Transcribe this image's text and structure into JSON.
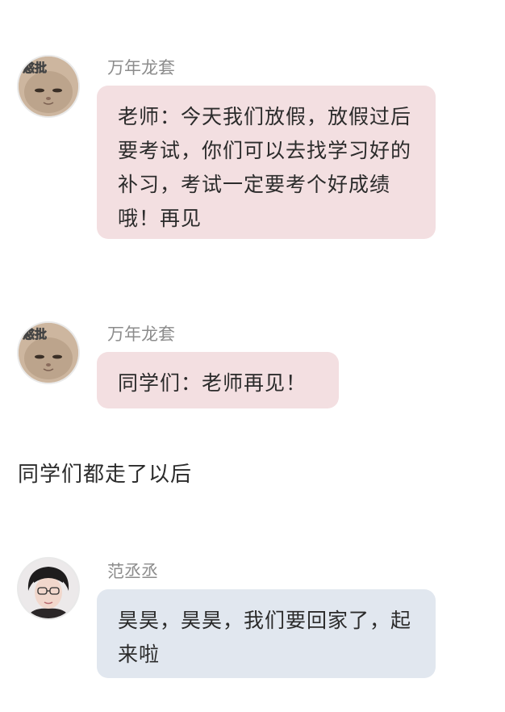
{
  "colors": {
    "teacher_bubble": "#f3dfe1",
    "student_bubble": "#e1e7ef",
    "sender_name": "#8c8c8c",
    "text": "#2b2b2b"
  },
  "messages": [
    {
      "sender": "万年龙套",
      "avatar_caption": "惑批",
      "avatar_icon": "cat-avatar-icon",
      "text": "老师：今天我们放假，放假过后要考试，你们可以去找学习好的补习，考试一定要考个好成绩哦！再见"
    },
    {
      "sender": "万年龙套",
      "avatar_caption": "惑批",
      "avatar_icon": "cat-avatar-icon",
      "text": "同学们：老师再见！"
    },
    {
      "sender": "范丞丞",
      "avatar_icon": "person-avatar-icon",
      "text": "昊昊，昊昊，我们要回家了，起来啦"
    }
  ],
  "narration": "同学们都走了以后"
}
